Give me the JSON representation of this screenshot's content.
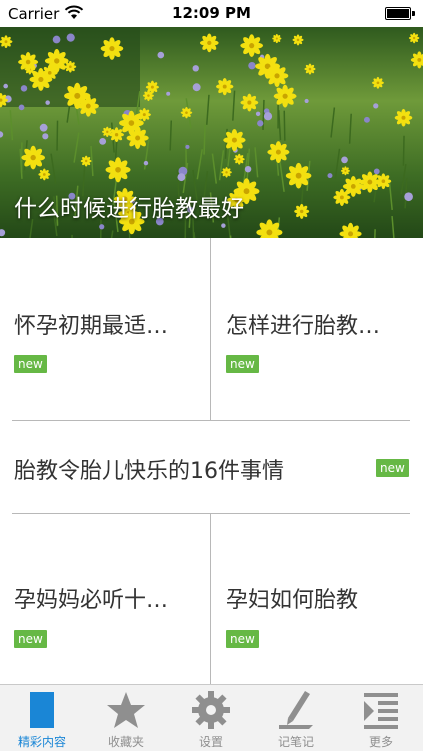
{
  "status_bar": {
    "carrier": "Carrier",
    "time": "12:09 PM"
  },
  "hero": {
    "caption": "什么时候进行胎教最好"
  },
  "articles": [
    {
      "title": "怀孕初期最适…",
      "badge": "new"
    },
    {
      "title": "怎样进行胎教…",
      "badge": "new"
    },
    {
      "title": "胎教令胎儿快乐的16件事情",
      "badge": "new"
    },
    {
      "title": "孕妈妈必听十…",
      "badge": "new"
    },
    {
      "title": "孕妇如何胎教",
      "badge": "new"
    }
  ],
  "tabs": [
    {
      "label": "精彩内容",
      "icon": "document-icon",
      "active": true
    },
    {
      "label": "收藏夹",
      "icon": "star-icon",
      "active": false
    },
    {
      "label": "设置",
      "icon": "gear-icon",
      "active": false
    },
    {
      "label": "记笔记",
      "icon": "pen-icon",
      "active": false
    },
    {
      "label": "更多",
      "icon": "list-icon",
      "active": false
    }
  ],
  "colors": {
    "badge": "#66b845",
    "active_tab": "#1a86d6",
    "inactive_tab": "#8f8f8f"
  }
}
